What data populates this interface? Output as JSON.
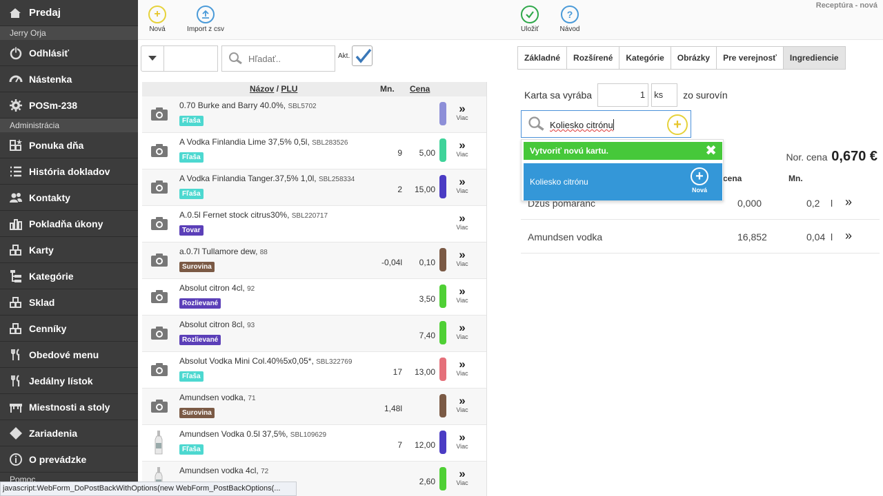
{
  "window": {
    "title": "Receptúra - nová"
  },
  "sidebar": {
    "top": {
      "label": "Predaj",
      "icon": "home-icon"
    },
    "user": "Jerry Orja",
    "logout": {
      "label": "Odhlásiť",
      "icon": "power-icon"
    },
    "items1": [
      {
        "label": "Nástenka",
        "icon": "dashboard-icon"
      },
      {
        "label": "POSm-238",
        "icon": "gear-icon"
      }
    ],
    "section": "Administrácia",
    "items2": [
      {
        "label": "Ponuka dňa",
        "icon": "grid-star-icon"
      },
      {
        "label": "História dokladov",
        "icon": "list-icon"
      },
      {
        "label": "Kontakty",
        "icon": "users-icon"
      },
      {
        "label": "Pokladňa úkony",
        "icon": "bar-chart-icon"
      },
      {
        "label": "Karty",
        "icon": "cards-icon"
      },
      {
        "label": "Kategórie",
        "icon": "sitemap-icon"
      },
      {
        "label": "Sklad",
        "icon": "warehouse-icon"
      },
      {
        "label": "Cenníky",
        "icon": "pricelist-icon"
      },
      {
        "label": "Obedové menu",
        "icon": "cutlery-icon"
      },
      {
        "label": "Jedálny lístok",
        "icon": "cutlery-icon"
      },
      {
        "label": "Miestnosti a stoly",
        "icon": "table-icon"
      },
      {
        "label": "Zariadenia",
        "icon": "diamond-icon"
      },
      {
        "label": "O prevádzke",
        "icon": "info-icon"
      }
    ],
    "cut_off": "Pomoc"
  },
  "toolbar": {
    "new_label": "Nová",
    "import_label": "Import z csv",
    "save_label": "Uložiť",
    "help_label": "Návod"
  },
  "filter": {
    "search_placeholder": "Hľadať..",
    "akt_label": "Akt."
  },
  "list": {
    "headers": {
      "name": "Názov",
      "sep": "/",
      "plu": "PLU",
      "qty": "Mn.",
      "price": "Cena"
    },
    "more_label": "Viac",
    "rows": [
      {
        "name": "0.70 Burke and Barry 40.0%,",
        "code": "SBL5702",
        "tag": "Fľaša",
        "tag_color": "#4dd8d0",
        "qty": "",
        "price": "",
        "bar": "#8d8fd8",
        "img": "camera"
      },
      {
        "name": "A Vodka Finlandia Lime 37,5% 0,5l,",
        "code": "SBL283526",
        "tag": "Fľaša",
        "tag_color": "#4dd8d0",
        "qty": "9",
        "price": "5,00",
        "bar": "#3fd39a",
        "img": "camera"
      },
      {
        "name": "A Vodka Finlandia Tanger.37,5% 1,0l,",
        "code": "SBL258334",
        "tag": "Fľaša",
        "tag_color": "#4dd8d0",
        "qty": "2",
        "price": "15,00",
        "bar": "#4b3cc4",
        "img": "camera"
      },
      {
        "name": "A.0.5l Fernet stock citrus30%,",
        "code": "SBL220717",
        "tag": "Tovar",
        "tag_color": "#5b3fb8",
        "qty": "",
        "price": "",
        "bar": "",
        "img": "camera"
      },
      {
        "name": "a.0.7l Tullamore dew,",
        "code": "88",
        "tag": "Surovina",
        "tag_color": "#7b5a45",
        "qty": "-0,04l",
        "price": "0,10",
        "bar": "#7b5a45",
        "img": "camera"
      },
      {
        "name": "Absolut citron 4cl,",
        "code": "92",
        "tag": "Rozlievané",
        "tag_color": "#5b3fb8",
        "qty": "",
        "price": "3,50",
        "bar": "#4fd035",
        "img": "camera"
      },
      {
        "name": "Absolut citron 8cl,",
        "code": "93",
        "tag": "Rozlievané",
        "tag_color": "#5b3fb8",
        "qty": "",
        "price": "7,40",
        "bar": "#4fd035",
        "img": "camera"
      },
      {
        "name": "Absolut Vodka Mini Col.40%5x0,05*,",
        "code": "SBL322769",
        "tag": "Fľaša",
        "tag_color": "#4dd8d0",
        "qty": "17",
        "price": "13,00",
        "bar": "#e5707a",
        "img": "camera"
      },
      {
        "name": "Amundsen vodka,",
        "code": "71",
        "tag": "Surovina",
        "tag_color": "#7b5a45",
        "qty": "1,48l",
        "price": "",
        "bar": "#7b5a45",
        "img": "camera"
      },
      {
        "name": "Amundsen Vodka 0.5l 37,5%,",
        "code": "SBL109629",
        "tag": "Fľaša",
        "tag_color": "#4dd8d0",
        "qty": "7",
        "price": "12,00",
        "bar": "#4b3cc4",
        "img": "bottle"
      },
      {
        "name": "Amundsen vodka 4cl,",
        "code": "72",
        "tag": "",
        "tag_color": "",
        "qty": "",
        "price": "2,60",
        "bar": "#4fd035",
        "img": "bottle"
      }
    ]
  },
  "tabs": [
    {
      "label": "Základné",
      "active": false
    },
    {
      "label": "Rozšírené",
      "active": false
    },
    {
      "label": "Kategórie",
      "active": false
    },
    {
      "label": "Obrázky",
      "active": false
    },
    {
      "label": "Pre verejnosť",
      "active": false
    },
    {
      "label": "Ingrediencie",
      "active": true
    }
  ],
  "recipe": {
    "produce_label": "Karta sa vyrába",
    "produce_qty": "1",
    "produce_unit": "ks",
    "produce_suffix": "zo surovín",
    "search_value": "Koliesko citrónu",
    "dropdown": {
      "create_label": "Vytvoriť novú kartu.",
      "option_label": "Koliesko citrónu",
      "option_new": "Nová"
    },
    "norm_price_label": "Nor. cena",
    "norm_price_value": "0,670 €",
    "headers": {
      "price": "cena",
      "qty": "Mn."
    },
    "ingredients": [
      {
        "name": "Džús pomaranč",
        "price": "0,000",
        "qty": "0,2",
        "unit": "l"
      },
      {
        "name": "Amundsen vodka",
        "price": "16,852",
        "qty": "0,04",
        "unit": "l"
      }
    ]
  },
  "statusbar": {
    "text": "javascript:WebForm_DoPostBackWithOptions(new WebForm_PostBackOptions(..."
  }
}
